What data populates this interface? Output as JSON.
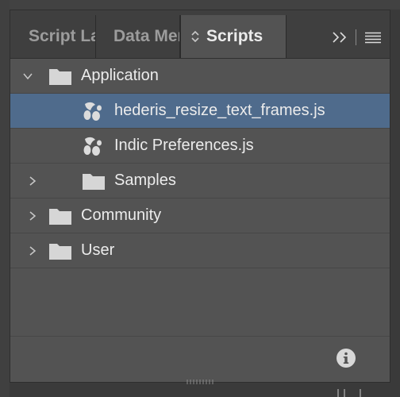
{
  "panel": {
    "tabs": [
      {
        "label": "Script Label",
        "active": false
      },
      {
        "label": "Data Merge",
        "active": false
      },
      {
        "label": "Scripts",
        "active": true
      }
    ]
  },
  "tree": {
    "items": [
      {
        "label": "Application",
        "icon": "folder-icon",
        "state": "expanded",
        "level": 0
      },
      {
        "label": "hederis_resize_text_frames.js",
        "icon": "script-icon",
        "state": "leaf",
        "level": 1,
        "selected": true
      },
      {
        "label": "Indic Preferences.js",
        "icon": "script-icon",
        "state": "leaf",
        "level": 1
      },
      {
        "label": "Samples",
        "icon": "folder-icon",
        "state": "collapsed",
        "level": 1
      },
      {
        "label": "Community",
        "icon": "folder-icon",
        "state": "collapsed",
        "level": 0
      },
      {
        "label": "User",
        "icon": "folder-icon",
        "state": "collapsed",
        "level": 0
      }
    ]
  },
  "colors": {
    "panel_bg": "#535353",
    "tabbar_bg": "#3f3f3f",
    "selection": "#4f6b8c",
    "text": "#ececec"
  }
}
